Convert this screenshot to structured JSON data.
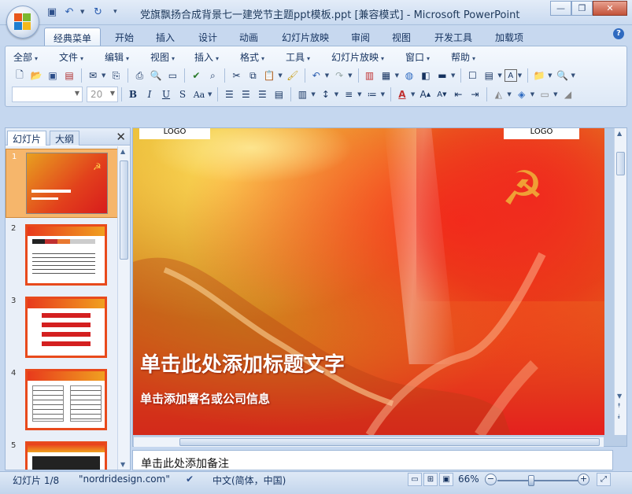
{
  "window": {
    "title": "党旗飘扬合成背景七一建党节主题ppt模板.ppt [兼容模式] - Microsoft PowerPoint",
    "minimize_icon": "minimize-icon",
    "restore_icon": "restore-icon",
    "close_icon": "close-icon"
  },
  "ribbon_tabs": [
    {
      "label": "经典菜单",
      "active": true
    },
    {
      "label": "开始"
    },
    {
      "label": "插入"
    },
    {
      "label": "设计"
    },
    {
      "label": "动画"
    },
    {
      "label": "幻灯片放映"
    },
    {
      "label": "审阅"
    },
    {
      "label": "视图"
    },
    {
      "label": "开发工具"
    },
    {
      "label": "加载项"
    }
  ],
  "menus": [
    "全部",
    "文件",
    "编辑",
    "视图",
    "插入",
    "格式",
    "工具",
    "幻灯片放映",
    "窗口",
    "帮助"
  ],
  "font": {
    "name": "",
    "size": "20"
  },
  "slides_pane": {
    "tabs": [
      "幻灯片",
      "大纲"
    ],
    "thumbnails": [
      "1",
      "2",
      "3",
      "4",
      "5"
    ],
    "selected": "1"
  },
  "slide": {
    "logo_left": "LOGO",
    "logo_right": "LOGO",
    "title": "单击此处添加标题文字",
    "subtitle": "单击添加署名或公司信息"
  },
  "notes": {
    "placeholder": "单击此处添加备注"
  },
  "status": {
    "slide_info": "幻灯片 1/8",
    "theme": "\"nordridesign.com\"",
    "language": "中文(简体，中国)",
    "zoom": "66%",
    "zoom_fraction": 0.4
  },
  "colors": {
    "accent": "#15325f",
    "slide_red": "#e4201e",
    "thumb_selected": "#f6b66b"
  }
}
